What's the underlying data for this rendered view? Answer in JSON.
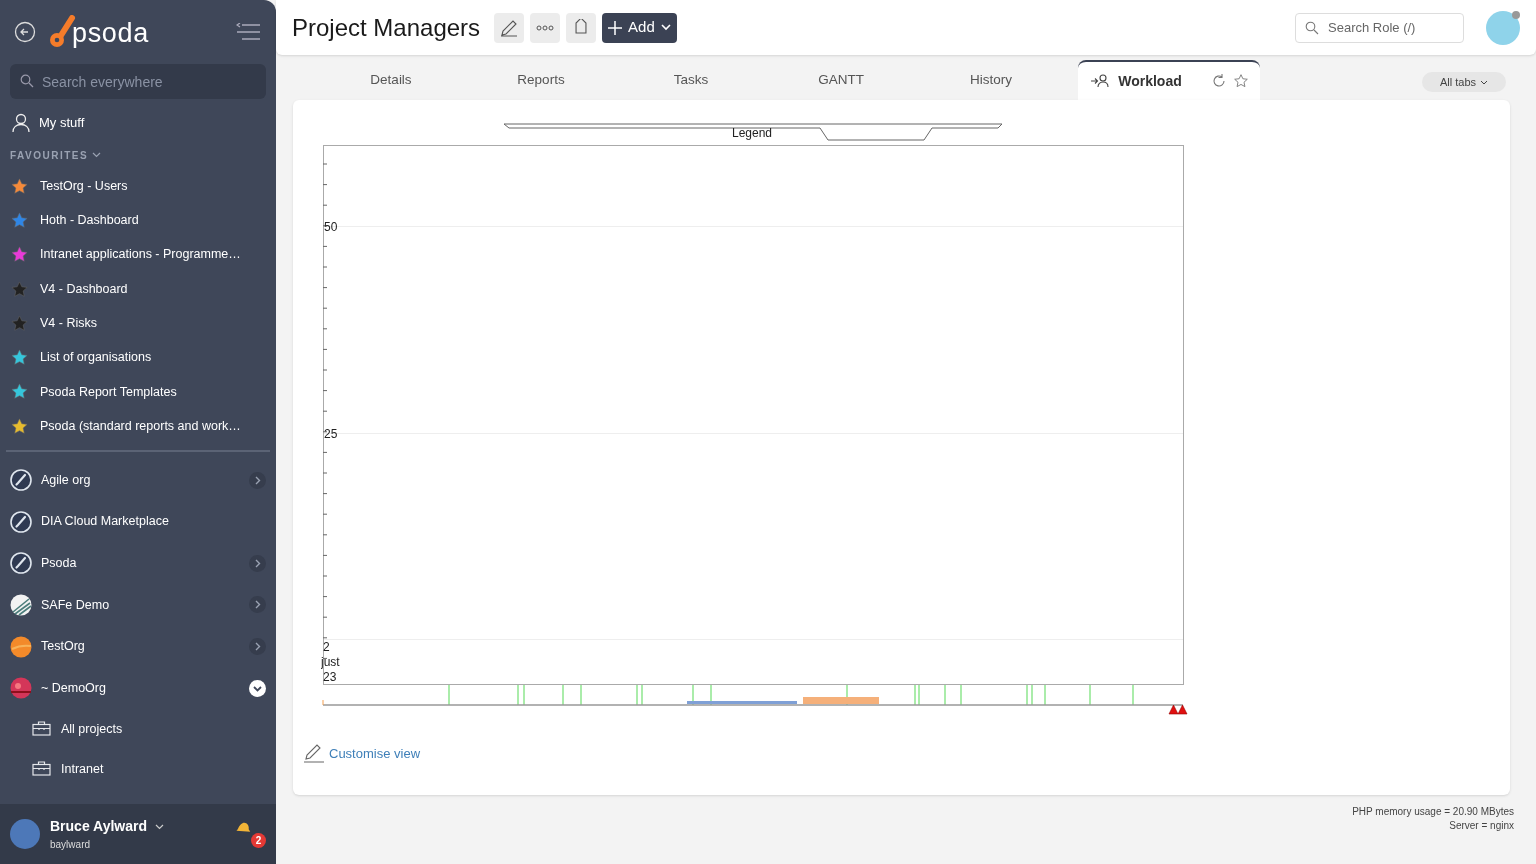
{
  "sidebar": {
    "logo": "psoda",
    "search": {
      "placeholder": "Search everywhere"
    },
    "my_stuff": "My stuff",
    "favourites_heading": "FAVOURITES",
    "favourites": [
      {
        "label": "TestOrg - Users",
        "color": "#f58a3a"
      },
      {
        "label": "Hoth - Dashboard",
        "color": "#2f86e6"
      },
      {
        "label": "Intranet applications - Programme…",
        "color": "#e83ad8"
      },
      {
        "label": "V4 - Dashboard",
        "color": "#222222"
      },
      {
        "label": "V4 - Risks",
        "color": "#222222"
      },
      {
        "label": "List of organisations",
        "color": "#35c6dc"
      },
      {
        "label": "Psoda Report Templates",
        "color": "#35c6dc"
      },
      {
        "label": "Psoda (standard reports and work…",
        "color": "#e6bb2e"
      }
    ],
    "organisations": [
      {
        "label": "Agile org",
        "kind": "rocket",
        "expanded": false
      },
      {
        "label": "DIA Cloud Marketplace",
        "kind": "rocket"
      },
      {
        "label": "Psoda",
        "kind": "rocket",
        "expanded": false
      },
      {
        "label": "SAFe Demo",
        "kind": "stripes",
        "expanded": false
      },
      {
        "label": "TestOrg",
        "kind": "orange",
        "expanded": false
      },
      {
        "label": "~ DemoOrg",
        "kind": "sunset",
        "expanded": true,
        "children": [
          {
            "label": "All projects"
          },
          {
            "label": "Intranet"
          }
        ]
      }
    ],
    "user": {
      "name": "Bruce Aylward",
      "username": "baylward",
      "notifications": "2"
    }
  },
  "header": {
    "title": "Project Managers",
    "add_button": "Add",
    "search": {
      "placeholder": "Search Role (/)"
    }
  },
  "tabs": [
    {
      "label": "Details",
      "selected": false
    },
    {
      "label": "Reports",
      "selected": false
    },
    {
      "label": "Tasks",
      "selected": false
    },
    {
      "label": "GANTT",
      "selected": false
    },
    {
      "label": "History",
      "selected": false
    },
    {
      "label": "Workload",
      "selected": true
    }
  ],
  "all_tabs": "All tabs",
  "workload_chart": {
    "legend": "Legend",
    "y_labels": [
      "50",
      "25"
    ],
    "date_lines": [
      "2",
      "just",
      "23"
    ]
  },
  "customise_link": "Customise view",
  "footer": [
    "PHP memory usage = 20.90 MBytes",
    "Server = nginx"
  ]
}
